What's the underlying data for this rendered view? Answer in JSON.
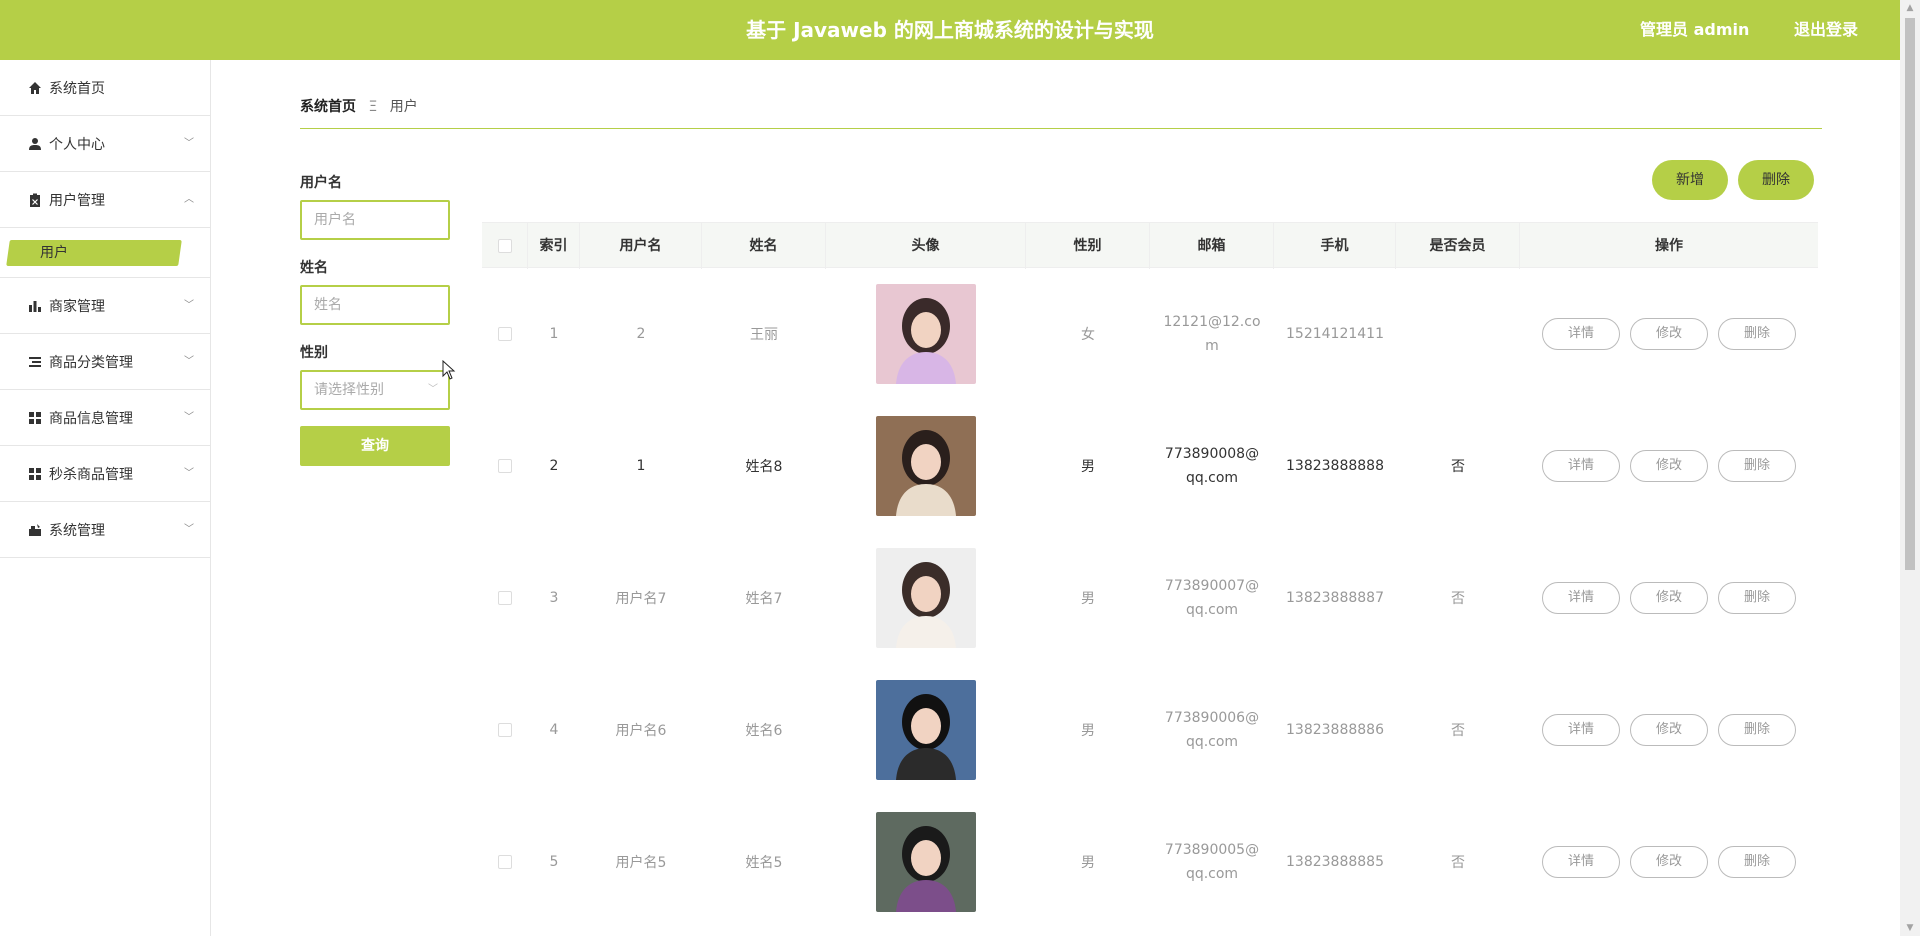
{
  "header": {
    "title": "基于 Javaweb 的网上商城系统的设计与实现",
    "user": "管理员 admin",
    "logout": "退出登录"
  },
  "sidebar": {
    "items": [
      {
        "label": "系统首页",
        "icon": "home-icon"
      },
      {
        "label": "个人中心",
        "icon": "person-icon"
      },
      {
        "label": "用户管理",
        "icon": "clipboard-icon"
      },
      {
        "label": "商家管理",
        "icon": "bar-chart-icon"
      },
      {
        "label": "商品分类管理",
        "icon": "list-icon"
      },
      {
        "label": "商品信息管理",
        "icon": "grid-icon"
      },
      {
        "label": "秒杀商品管理",
        "icon": "grid-icon"
      },
      {
        "label": "系统管理",
        "icon": "settings-icon"
      }
    ],
    "active_sub": "用户"
  },
  "breadcrumb": {
    "home": "系统首页",
    "separator": "Ξ",
    "current": "用户"
  },
  "search": {
    "username_label": "用户名",
    "username_placeholder": "用户名",
    "name_label": "姓名",
    "name_placeholder": "姓名",
    "gender_label": "性别",
    "gender_placeholder": "请选择性别",
    "query_button": "查询"
  },
  "actions": {
    "add": "新增",
    "delete": "删除"
  },
  "table": {
    "columns": [
      "索引",
      "用户名",
      "姓名",
      "头像",
      "性别",
      "邮箱",
      "手机",
      "是否会员",
      "操作"
    ],
    "row_buttons": {
      "detail": "详情",
      "edit": "修改",
      "delete": "删除"
    },
    "rows": [
      {
        "index": "1",
        "username": "2",
        "name": "王丽",
        "gender": "女",
        "email": "12121@12.com",
        "phone": "15214121411",
        "member": "",
        "style": "light"
      },
      {
        "index": "2",
        "username": "1",
        "name": "姓名8",
        "gender": "男",
        "email": "773890008@qq.com",
        "phone": "13823888888",
        "member": "否",
        "style": "dark"
      },
      {
        "index": "3",
        "username": "用户名7",
        "name": "姓名7",
        "gender": "男",
        "email": "773890007@qq.com",
        "phone": "13823888887",
        "member": "否",
        "style": "light"
      },
      {
        "index": "4",
        "username": "用户名6",
        "name": "姓名6",
        "gender": "男",
        "email": "773890006@qq.com",
        "phone": "13823888886",
        "member": "否",
        "style": "light"
      },
      {
        "index": "5",
        "username": "用户名5",
        "name": "姓名5",
        "gender": "男",
        "email": "773890005@qq.com",
        "phone": "13823888885",
        "member": "否",
        "style": "light"
      }
    ]
  },
  "colors": {
    "accent": "#b5cf47"
  }
}
